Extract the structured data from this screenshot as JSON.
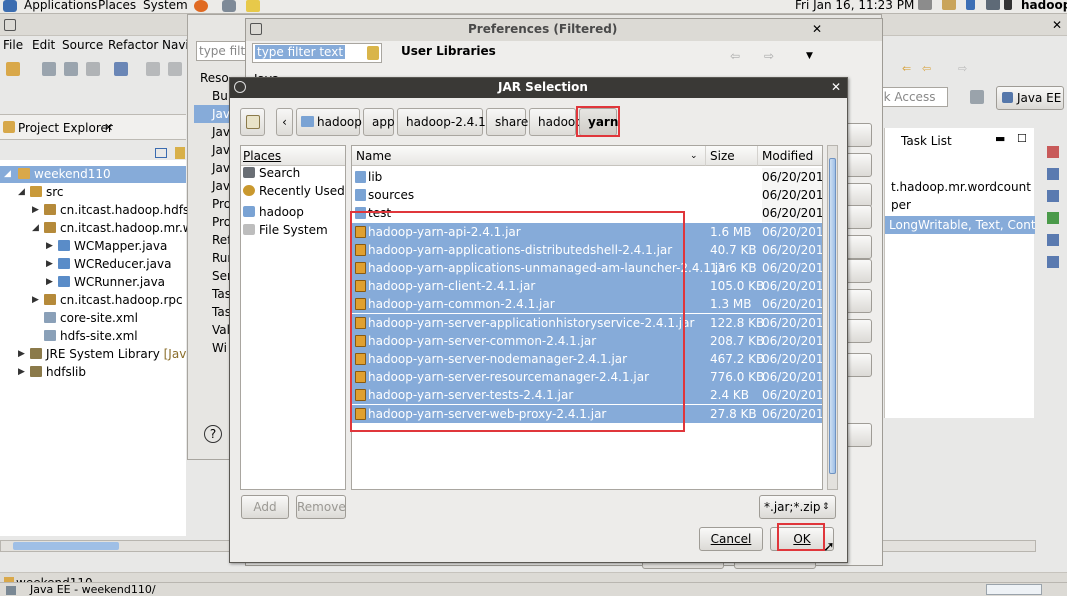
{
  "top_panel": {
    "applications": "Applications",
    "places": "Places",
    "system": "System",
    "clock": "Fri Jan 16, 11:23 PM",
    "user": "hadoop"
  },
  "eclipse": {
    "menu": [
      "File",
      "Edit",
      "Source",
      "Refactor",
      "Navi"
    ],
    "project_explorer_title": "Project Explorer",
    "quick_access": "ck Access",
    "perspective": "Java EE",
    "task_list_title": "Task List",
    "task_lines": [
      "t.hadoop.mr.wordcount",
      "per",
      "LongWritable, Text, Context) :"
    ],
    "status_left": "weekend110",
    "taskbar_item": "Java EE - weekend110/",
    "tree": [
      {
        "label": "weekend110",
        "indent": 0
      },
      {
        "label": "src",
        "indent": 1
      },
      {
        "label": "cn.itcast.hadoop.hdfs",
        "indent": 2
      },
      {
        "label": "cn.itcast.hadoop.mr.wordc",
        "indent": 2
      },
      {
        "label": "WCMapper.java",
        "indent": 3
      },
      {
        "label": "WCReducer.java",
        "indent": 3
      },
      {
        "label": "WCRunner.java",
        "indent": 3
      },
      {
        "label": "cn.itcast.hadoop.rpc",
        "indent": 2
      },
      {
        "label": "core-site.xml",
        "indent": 2
      },
      {
        "label": "hdfs-site.xml",
        "indent": 2
      },
      {
        "label": "JRE System Library",
        "indent": 1
      },
      {
        "label": "hdfslib",
        "indent": 1
      }
    ],
    "jre_suffix": "[JavaSE"
  },
  "preferences": {
    "title": "Preferences (Filtered)",
    "filter_placeholder": "type filter text",
    "filter_back_placeholder": "type filte",
    "page_title": "User Libraries",
    "left_items": [
      "Reso",
      "Bu",
      "Jav",
      "Jav",
      "Jav",
      "Jav",
      "Jav",
      "Pro",
      "Pro",
      "Ref",
      "Run",
      "Ser",
      "Tas",
      "Tas",
      "Val",
      "Wi"
    ],
    "right_java": "Java"
  },
  "jar_dialog": {
    "title": "JAR Selection",
    "path": [
      "hadoop",
      "app",
      "hadoop-2.4.1",
      "share",
      "hadoop",
      "yarn"
    ],
    "places_header": "Places",
    "places": [
      "Search",
      "Recently Used",
      "hadoop",
      "File System"
    ],
    "columns": {
      "name": "Name",
      "size": "Size",
      "modified": "Modified"
    },
    "files": [
      {
        "name": "lib",
        "size": "",
        "modified": "06/20/2014",
        "type": "folder",
        "selected": false
      },
      {
        "name": "sources",
        "size": "",
        "modified": "06/20/2014",
        "type": "folder",
        "selected": false
      },
      {
        "name": "test",
        "size": "",
        "modified": "06/20/2014",
        "type": "folder",
        "selected": false
      },
      {
        "name": "hadoop-yarn-api-2.4.1.jar",
        "size": "1.6 MB",
        "modified": "06/20/2014",
        "type": "jar",
        "selected": true
      },
      {
        "name": "hadoop-yarn-applications-distributedshell-2.4.1.jar",
        "size": "40.7 KB",
        "modified": "06/20/2014",
        "type": "jar",
        "selected": true
      },
      {
        "name": "hadoop-yarn-applications-unmanaged-am-launcher-2.4.1.jar",
        "size": "13.6 KB",
        "modified": "06/20/2014",
        "type": "jar",
        "selected": true
      },
      {
        "name": "hadoop-yarn-client-2.4.1.jar",
        "size": "105.0 KB",
        "modified": "06/20/2014",
        "type": "jar",
        "selected": true
      },
      {
        "name": "hadoop-yarn-common-2.4.1.jar",
        "size": "1.3 MB",
        "modified": "06/20/2014",
        "type": "jar",
        "selected": true
      },
      {
        "name": "hadoop-yarn-server-applicationhistoryservice-2.4.1.jar",
        "size": "122.8 KB",
        "modified": "06/20/2014",
        "type": "jar",
        "selected": true
      },
      {
        "name": "hadoop-yarn-server-common-2.4.1.jar",
        "size": "208.7 KB",
        "modified": "06/20/2014",
        "type": "jar",
        "selected": true
      },
      {
        "name": "hadoop-yarn-server-nodemanager-2.4.1.jar",
        "size": "467.2 KB",
        "modified": "06/20/2014",
        "type": "jar",
        "selected": true
      },
      {
        "name": "hadoop-yarn-server-resourcemanager-2.4.1.jar",
        "size": "776.0 KB",
        "modified": "06/20/2014",
        "type": "jar",
        "selected": true
      },
      {
        "name": "hadoop-yarn-server-tests-2.4.1.jar",
        "size": "2.4 KB",
        "modified": "06/20/2014",
        "type": "jar",
        "selected": true
      },
      {
        "name": "hadoop-yarn-server-web-proxy-2.4.1.jar",
        "size": "27.8 KB",
        "modified": "06/20/2014",
        "type": "jar",
        "selected": true
      }
    ],
    "add_label": "Add",
    "remove_label": "Remove",
    "filter_value": "*.jar;*.zip",
    "cancel_label": "Cancel",
    "ok_label": "OK"
  },
  "colors": {
    "selection": "#86abd9",
    "highlight_box": "#e0363b",
    "title_bar": "#3a3936",
    "folder": "#7aa3d4",
    "jar": "#e0a030"
  }
}
